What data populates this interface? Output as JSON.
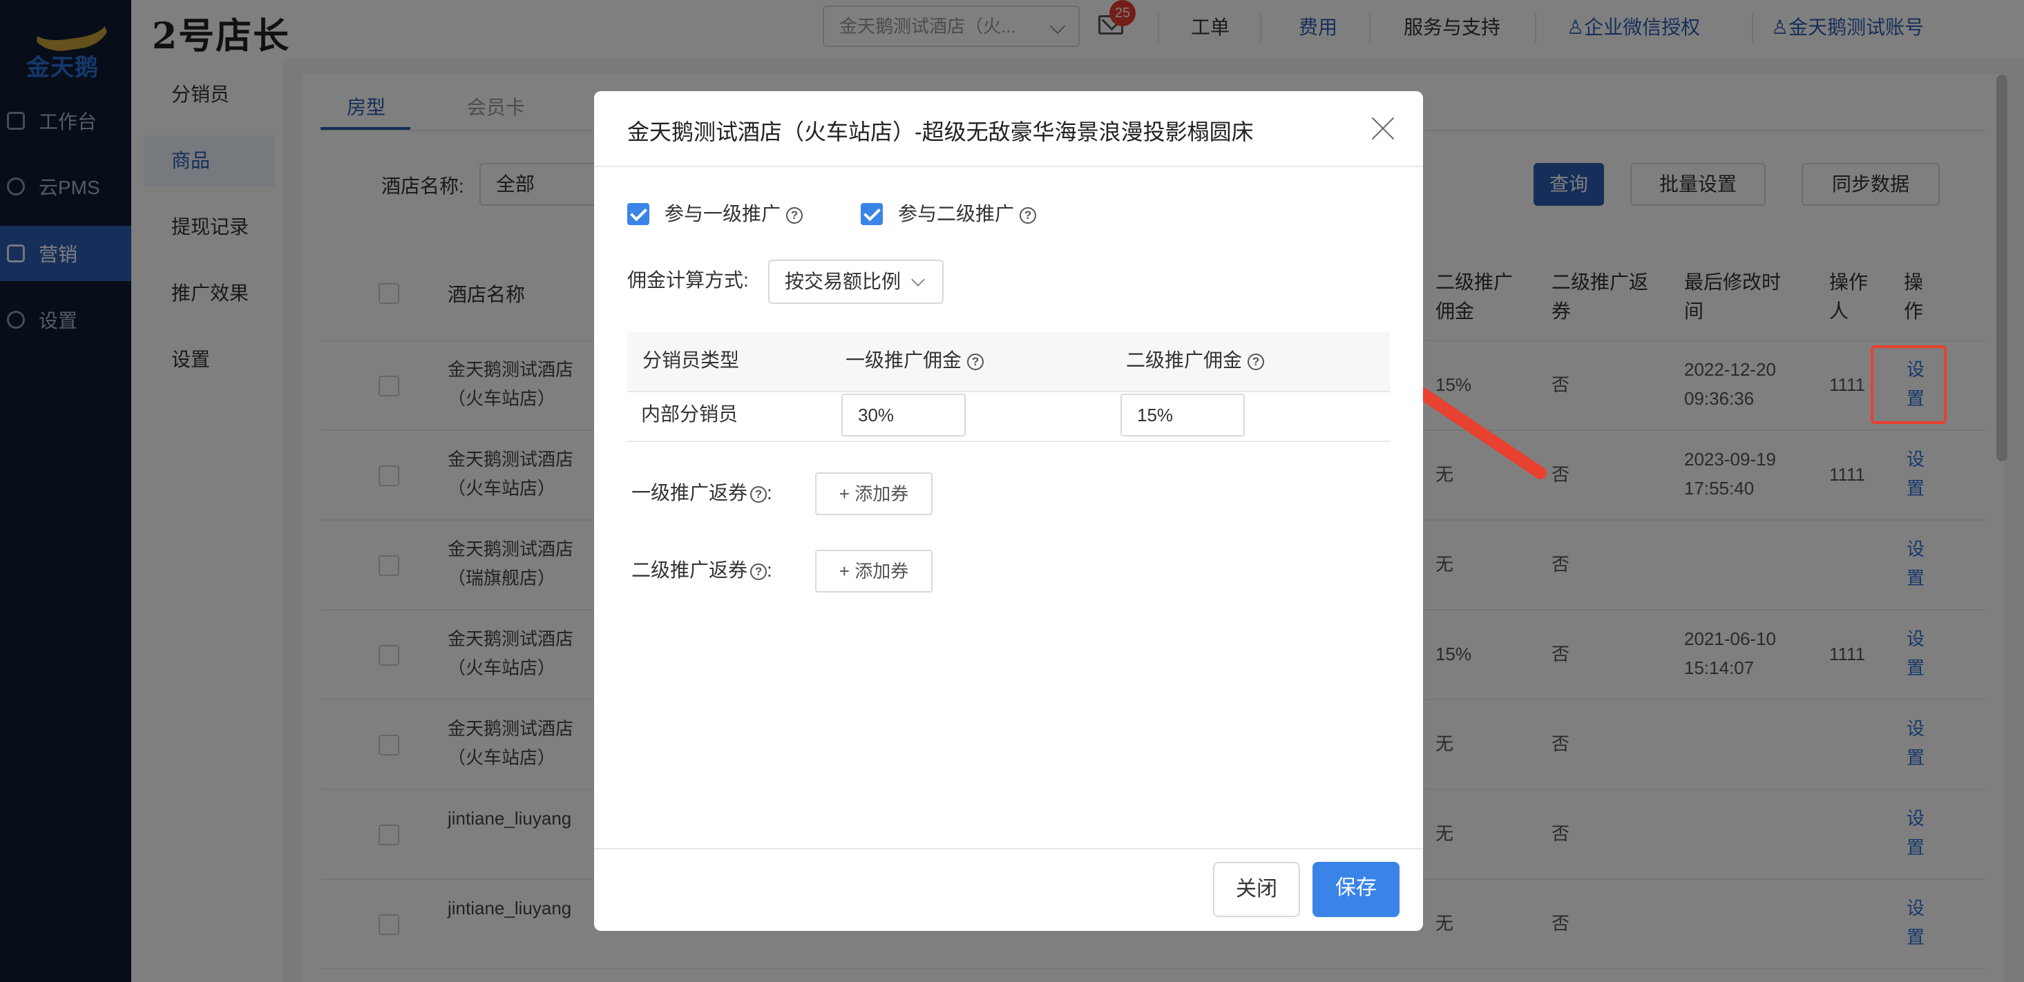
{
  "app": {
    "logo_text": "金天鹅",
    "brand": "2号店长"
  },
  "sidebar": {
    "items": [
      {
        "label": "工作台",
        "icon": "workbench-icon"
      },
      {
        "label": "云PMS",
        "icon": "gear-icon"
      },
      {
        "label": "营销",
        "icon": "marketing-icon",
        "active": true
      },
      {
        "label": "设置",
        "icon": "gear-icon"
      }
    ]
  },
  "header": {
    "hotel_select": "金天鹅测试酒店（火...",
    "mail_badge": "25",
    "links": [
      "工单",
      "费用",
      "服务与支持",
      "企业微信授权",
      "金天鹅测试账号"
    ]
  },
  "subnav": {
    "items": [
      {
        "label": "分销员"
      },
      {
        "label": "商品",
        "active": true
      },
      {
        "label": "提现记录"
      },
      {
        "label": "推广效果"
      },
      {
        "label": "设置"
      }
    ]
  },
  "main": {
    "tabs": [
      "房型",
      "会员卡"
    ],
    "filter_label": "酒店名称:",
    "filter_value": "全部",
    "buttons": {
      "query": "查询",
      "batch": "批量设置",
      "sync": "同步数据"
    },
    "columns": {
      "hotel": "酒店名称",
      "second_commission": "二级推广佣金",
      "second_coupon": "二级推广返券",
      "modified": "最后修改时间",
      "operator": "操作人",
      "action": "操作"
    },
    "rows": [
      {
        "hotel": "金天鹅测试酒店（火车站店）",
        "commission": "15%",
        "coupon": "否",
        "modified": "2022-12-20 09:36:36",
        "operator": "1111",
        "action": "设置"
      },
      {
        "hotel": "金天鹅测试酒店（火车站店）",
        "commission": "无",
        "coupon": "否",
        "modified": "2023-09-19 17:55:40",
        "operator": "1111",
        "action": "设置"
      },
      {
        "hotel": "金天鹅测试酒店（瑞旗舰店）",
        "commission": "无",
        "coupon": "否",
        "modified": "",
        "operator": "",
        "action": "设置"
      },
      {
        "hotel": "金天鹅测试酒店（火车站店）",
        "commission": "15%",
        "coupon": "否",
        "modified": "2021-06-10 15:14:07",
        "operator": "1111",
        "action": "设置"
      },
      {
        "hotel": "金天鹅测试酒店（火车站店）",
        "commission": "无",
        "coupon": "否",
        "modified": "",
        "operator": "",
        "action": "设置"
      },
      {
        "hotel": "jintiane_liuyang",
        "commission": "无",
        "coupon": "否",
        "modified": "",
        "operator": "",
        "action": "设置"
      },
      {
        "hotel": "jintiane_liuyang",
        "commission": "无",
        "coupon": "否",
        "modified": "",
        "operator": "",
        "action": "设置"
      }
    ]
  },
  "modal": {
    "title": "金天鹅测试酒店（火车站店）-超级无敌豪华海景浪漫投影榻圆床",
    "checkbox_level1": "参与一级推广",
    "checkbox_level2": "参与二级推广",
    "calc_label": "佣金计算方式:",
    "calc_value": "按交易额比例",
    "table_headers": [
      "分销员类型",
      "一级推广佣金",
      "二级推广佣金"
    ],
    "table_row": {
      "type": "内部分销员",
      "level1": "30%",
      "level2": "15%"
    },
    "coupon_level1_label": "一级推广返券",
    "coupon_level2_label": "二级推广返券",
    "add_coupon": "+ 添加券",
    "close": "关闭",
    "save": "保存"
  },
  "colors": {
    "accent": "#2b5fb4",
    "primary_button": "#3a84e8",
    "annotation": "#e8412f"
  }
}
